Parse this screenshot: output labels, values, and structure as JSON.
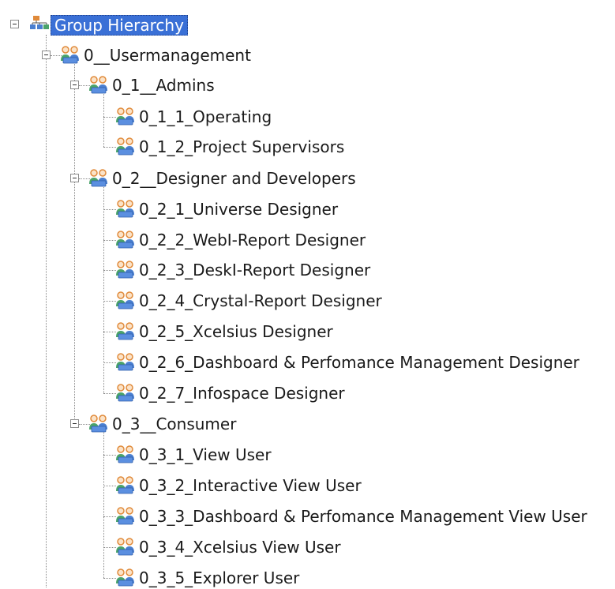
{
  "tree": {
    "root": {
      "label": "Group Hierarchy",
      "icon": "org-hierarchy-icon",
      "selected": true,
      "expanded": true,
      "children": [
        {
          "label": "0__Usermanagement",
          "icon": "user-group-icon",
          "expanded": true,
          "children": [
            {
              "label": "0_1__Admins",
              "icon": "user-group-icon",
              "expanded": true,
              "children": [
                {
                  "label": "0_1_1_Operating",
                  "icon": "user-group-icon"
                },
                {
                  "label": "0_1_2_Project Supervisors",
                  "icon": "user-group-icon"
                }
              ]
            },
            {
              "label": "0_2__Designer and Developers",
              "icon": "user-group-icon",
              "expanded": true,
              "children": [
                {
                  "label": "0_2_1_Universe Designer",
                  "icon": "user-group-icon"
                },
                {
                  "label": "0_2_2_WebI-Report Designer",
                  "icon": "user-group-icon"
                },
                {
                  "label": "0_2_3_DeskI-Report Designer",
                  "icon": "user-group-icon"
                },
                {
                  "label": "0_2_4_Crystal-Report Designer",
                  "icon": "user-group-icon"
                },
                {
                  "label": "0_2_5_Xcelsius Designer",
                  "icon": "user-group-icon"
                },
                {
                  "label": "0_2_6_Dashboard & Perfomance Management Designer",
                  "icon": "user-group-icon"
                },
                {
                  "label": "0_2_7_Infospace Designer",
                  "icon": "user-group-icon"
                }
              ]
            },
            {
              "label": "0_3__Consumer",
              "icon": "user-group-icon",
              "expanded": true,
              "children": [
                {
                  "label": "0_3_1_View User",
                  "icon": "user-group-icon"
                },
                {
                  "label": "0_3_2_Interactive View User",
                  "icon": "user-group-icon"
                },
                {
                  "label": "0_3_3_Dashboard & Perfomance Management View User",
                  "icon": "user-group-icon"
                },
                {
                  "label": "0_3_4_Xcelsius View User",
                  "icon": "user-group-icon"
                },
                {
                  "label": "0_3_5_Explorer User",
                  "icon": "user-group-icon"
                }
              ]
            }
          ]
        }
      ]
    }
  },
  "colors": {
    "selection_bg": "#3a70d6",
    "group_icon_orange": "#e08a3a",
    "group_icon_blue": "#4a7fd0",
    "group_icon_green": "#4aa36a"
  }
}
